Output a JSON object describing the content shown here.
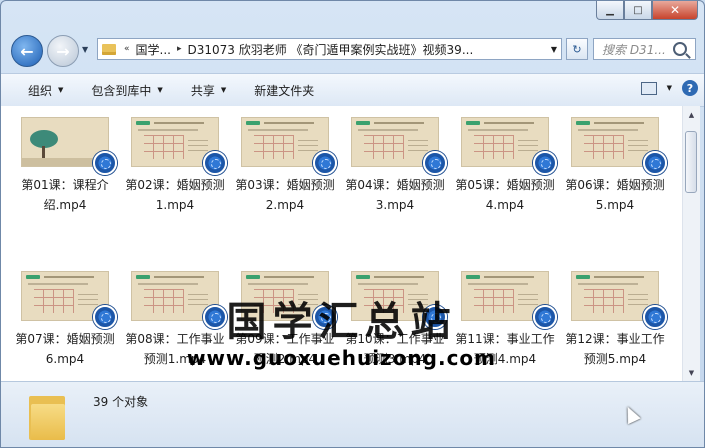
{
  "window": {
    "minimize_glyph": "▁",
    "maximize_glyph": "□",
    "close_glyph": "✕"
  },
  "address": {
    "chevrons": "«",
    "crumbs": [
      "国学...",
      "D31073 欣羽老师 《奇门遁甲案例实战班》视频39..."
    ],
    "separator": "▸",
    "dropdown_glyph": "▼",
    "refresh_glyph": "↻"
  },
  "nav": {
    "back_glyph": "←",
    "forward_glyph": "→",
    "history_glyph": "▼"
  },
  "search": {
    "placeholder": "搜索 D31..."
  },
  "toolbar": {
    "organize": "组织",
    "include_in_library": "包含到库中",
    "share": "共享",
    "new_folder": "新建文件夹",
    "arrow_glyph": "▼",
    "help_glyph": "?"
  },
  "files": [
    {
      "name": "第01课：课程介绍.mp4",
      "thumb": "intro"
    },
    {
      "name": "第02课：婚姻预测1.mp4",
      "thumb": "chart"
    },
    {
      "name": "第03课：婚姻预测2.mp4",
      "thumb": "chart"
    },
    {
      "name": "第04课：婚姻预测3.mp4",
      "thumb": "chart"
    },
    {
      "name": "第05课：婚姻预测4.mp4",
      "thumb": "chart"
    },
    {
      "name": "第06课：婚姻预测5.mp4",
      "thumb": "chart"
    },
    {
      "name": "第07课：婚姻预测6.mp4",
      "thumb": "chart"
    },
    {
      "name": "第08课：工作事业预测1.mp4",
      "thumb": "chart"
    },
    {
      "name": "第09课：工作事业预测2.mp4",
      "thumb": "chart"
    },
    {
      "name": "第10课：工作事业预测3.mp4",
      "thumb": "chart"
    },
    {
      "name": "第11课：事业工作预测4.mp4",
      "thumb": "chart"
    },
    {
      "name": "第12课：事业工作预测5.mp4",
      "thumb": "chart"
    }
  ],
  "watermark": {
    "title": "国学汇总站",
    "url": "www.guoxuehuizong.com"
  },
  "status": {
    "count_text": "39 个对象"
  },
  "scroll": {
    "up_glyph": "▲",
    "down_glyph": "▼"
  },
  "icons": [
    "back-arrow-icon",
    "forward-arrow-icon",
    "folder-icon",
    "refresh-icon",
    "search-icon",
    "view-icon",
    "help-icon",
    "video-file-badge-icon",
    "cursor-icon"
  ]
}
